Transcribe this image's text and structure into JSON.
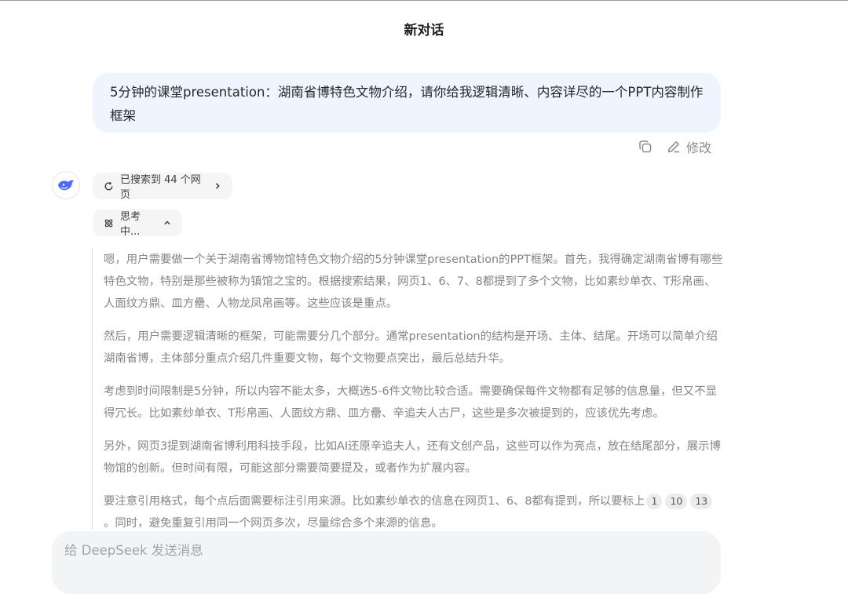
{
  "header": {
    "title": "新对话"
  },
  "user_message": {
    "text": "5分钟的课堂presentation：湖南省博特色文物介绍，请你给我逻辑清晰、内容详尽的一个PPT内容制作框架"
  },
  "message_actions": {
    "copy_icon": "copy-icon",
    "edit_icon": "pencil-icon",
    "edit_label": "修改"
  },
  "assistant": {
    "avatar_icon": "deepseek-whale-icon",
    "search_chip_label": "已搜索到 44 个网页",
    "thinking_chip_label": "思考中...",
    "paragraphs": [
      "嗯，用户需要做一个关于湖南省博物馆特色文物介绍的5分钟课堂presentation的PPT框架。首先，我得确定湖南省博有哪些特色文物，特别是那些被称为镇馆之宝的。根据搜索结果，网页1、6、7、8都提到了多个文物，比如素纱单衣、T形帛画、人面纹方鼎、皿方罍、人物龙凤帛画等。这些应该是重点。",
      "然后，用户需要逻辑清晰的框架，可能需要分几个部分。通常presentation的结构是开场、主体、结尾。开场可以简单介绍湖南省博，主体部分重点介绍几件重要文物，每个文物要点突出，最后总结升华。",
      "考虑到时间限制是5分钟，所以内容不能太多，大概选5-6件文物比较合适。需要确保每件文物都有足够的信息量，但又不显得冗长。比如素纱单衣、T形帛画、人面纹方鼎、皿方罍、辛追夫人古尸，这些是多次被提到的，应该优先考虑。",
      "另外，网页3提到湖南省博利用科技手段，比如AI还原辛追夫人，还有文创产品，这些可以作为亮点，放在结尾部分，展示博物馆的创新。但时间有限，可能这部分需要简要提及，或者作为扩展内容。"
    ],
    "last_paragraph_start": "要注意引用格式，每个点后面需要标注引用来源。比如素纱单衣的信息在网页1、6、8都有提到，所以要标上",
    "citations": [
      "1",
      "10",
      "13"
    ],
    "last_paragraph_end": "。同时，避免重复引用同一个网页多次，尽量综合多个来源的信息。"
  },
  "input": {
    "placeholder": "给 DeepSeek 发送消息"
  },
  "colors": {
    "user_bubble": "#eef5fe",
    "chip_bg": "#f5f5f5",
    "thinking_text": "#858585",
    "input_bg": "#f3f4f6"
  }
}
